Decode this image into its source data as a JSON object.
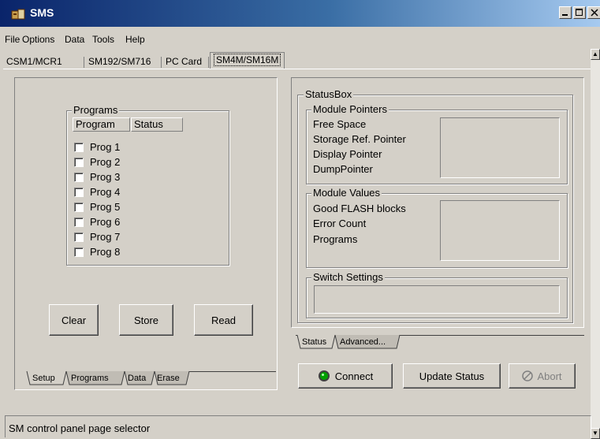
{
  "window": {
    "title": "SMS"
  },
  "menu": [
    "File",
    "Options",
    "Data",
    "Tools",
    "Help"
  ],
  "top_tabs": [
    "CSM1/MCR1",
    "SM192/SM716",
    "PC Card",
    "SM4M/SM16M"
  ],
  "programs": {
    "group_label": "Programs",
    "columns": [
      "Program",
      "Status"
    ],
    "items": [
      "Prog 1",
      "Prog 2",
      "Prog 3",
      "Prog 4",
      "Prog 5",
      "Prog 6",
      "Prog 7",
      "Prog 8"
    ]
  },
  "left_buttons": {
    "clear": "Clear",
    "store": "Store",
    "read": "Read"
  },
  "left_tabs": [
    "Setup",
    "Programs",
    "Data",
    "Erase"
  ],
  "statusbox": {
    "label": "StatusBox",
    "pointers": {
      "label": "Module Pointers",
      "items": [
        "Free Space",
        "Storage Ref. Pointer",
        "Display Pointer",
        "DumpPointer"
      ]
    },
    "values": {
      "label": "Module Values",
      "items": [
        "Good FLASH blocks",
        "Error Count",
        "Programs"
      ]
    },
    "switch": {
      "label": "Switch Settings"
    }
  },
  "right_tabs": [
    "Status",
    "Advanced..."
  ],
  "right_buttons": {
    "connect": "Connect",
    "update": "Update Status",
    "abort": "Abort"
  },
  "status_bar": {
    "text": "SM control panel page selector"
  },
  "colors": {
    "title_bar": "#0a246a",
    "face": "#d4d0c8",
    "connect_led": "#00a000"
  }
}
